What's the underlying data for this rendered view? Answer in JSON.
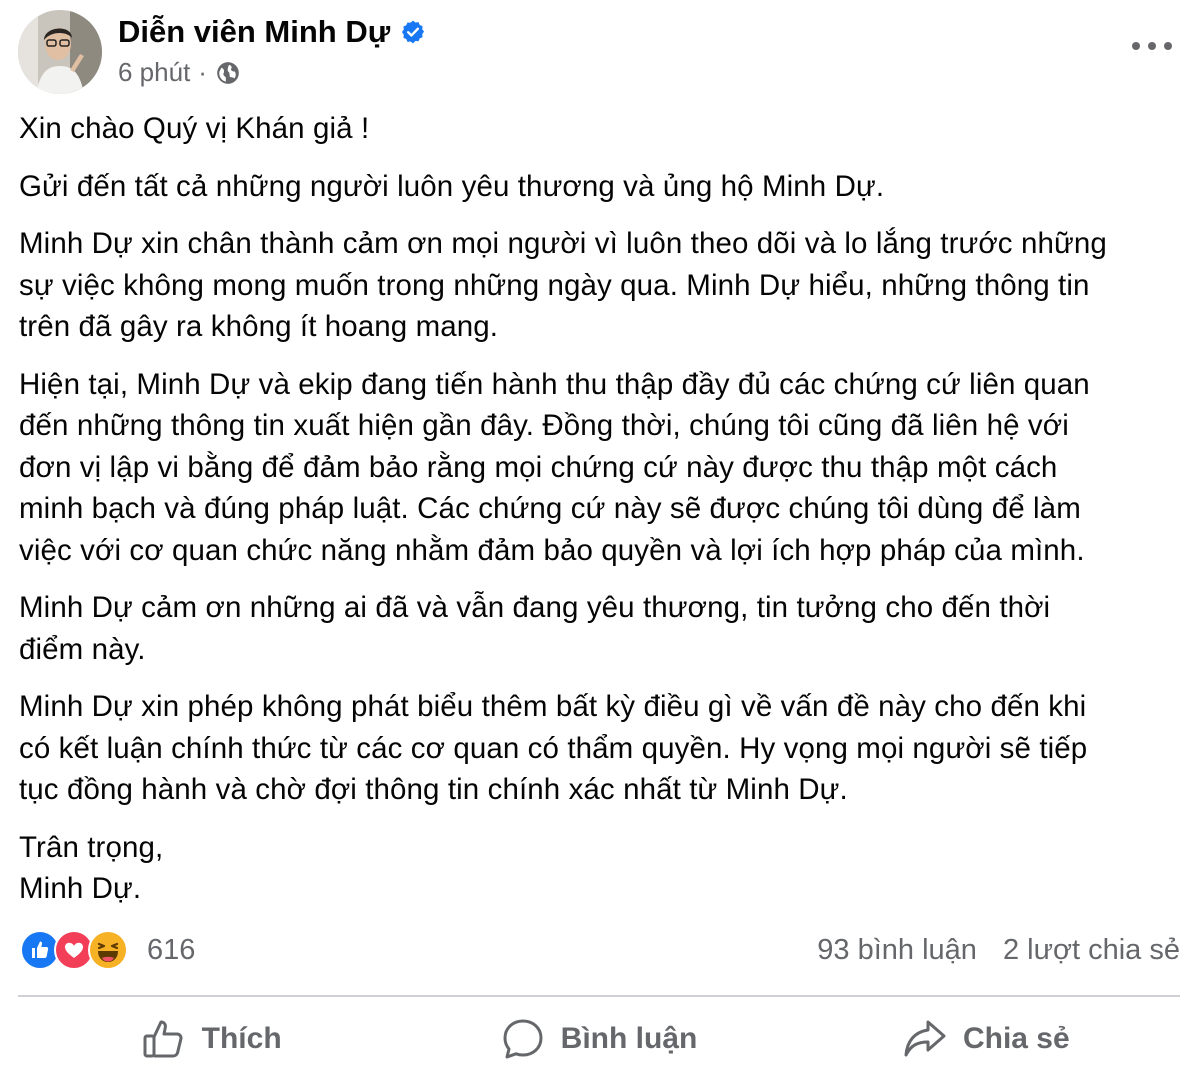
{
  "post": {
    "author": "Diễn viên Minh Dự",
    "time": "6 phút",
    "separator": "·",
    "paragraphs": [
      [
        "Xin chào Quý vị Khán giả !"
      ],
      [
        "Gửi đến tất cả những người luôn yêu thương và ủng hộ Minh Dự."
      ],
      [
        "Minh Dự xin chân thành cảm ơn mọi người vì luôn theo dõi và lo lắng trước những",
        "sự việc không mong muốn trong những ngày qua. Minh Dự hiểu, những thông tin",
        "trên đã gây ra không ít hoang mang."
      ],
      [
        "Hiện tại, Minh Dự và ekip đang tiến hành thu thập đầy đủ các chứng cứ liên quan",
        "đến những thông tin xuất hiện gần đây. Đồng thời, chúng tôi cũng đã liên hệ với",
        "đơn vị lập vi bằng để đảm bảo rằng mọi chứng cứ này được thu thập một cách",
        "minh bạch và đúng pháp luật. Các chứng cứ này sẽ được chúng tôi dùng để làm",
        "việc với cơ quan chức năng nhằm đảm bảo quyền và lợi ích hợp pháp của mình."
      ],
      [
        "Minh Dự cảm ơn những ai đã và vẫn đang yêu thương, tin tưởng cho đến thời",
        "điểm này."
      ],
      [
        "Minh Dự xin phép không phát biểu thêm bất kỳ điều gì về vấn đề này cho đến khi",
        "có kết luận chính thức từ các cơ quan có thẩm quyền. Hy vọng mọi người sẽ tiếp",
        "tục đồng hành và chờ đợi thông tin chính xác nhất từ Minh Dự."
      ],
      [
        "Trân trọng,",
        "Minh Dự."
      ]
    ]
  },
  "engagement": {
    "reactions": [
      "like-icon",
      "love-icon",
      "haha-icon"
    ],
    "reaction_count": "616",
    "comments": "93 bình luận",
    "shares": "2 lượt chia sẻ"
  },
  "actions": {
    "like": "Thích",
    "comment": "Bình luận",
    "share": "Chia sẻ"
  },
  "colors": {
    "secondary_text": "#65676b",
    "verified_blue": "#1877f2",
    "like_blue": "#1877f2",
    "love_red": "#f33e58",
    "haha_yellow": "#f7b125"
  }
}
